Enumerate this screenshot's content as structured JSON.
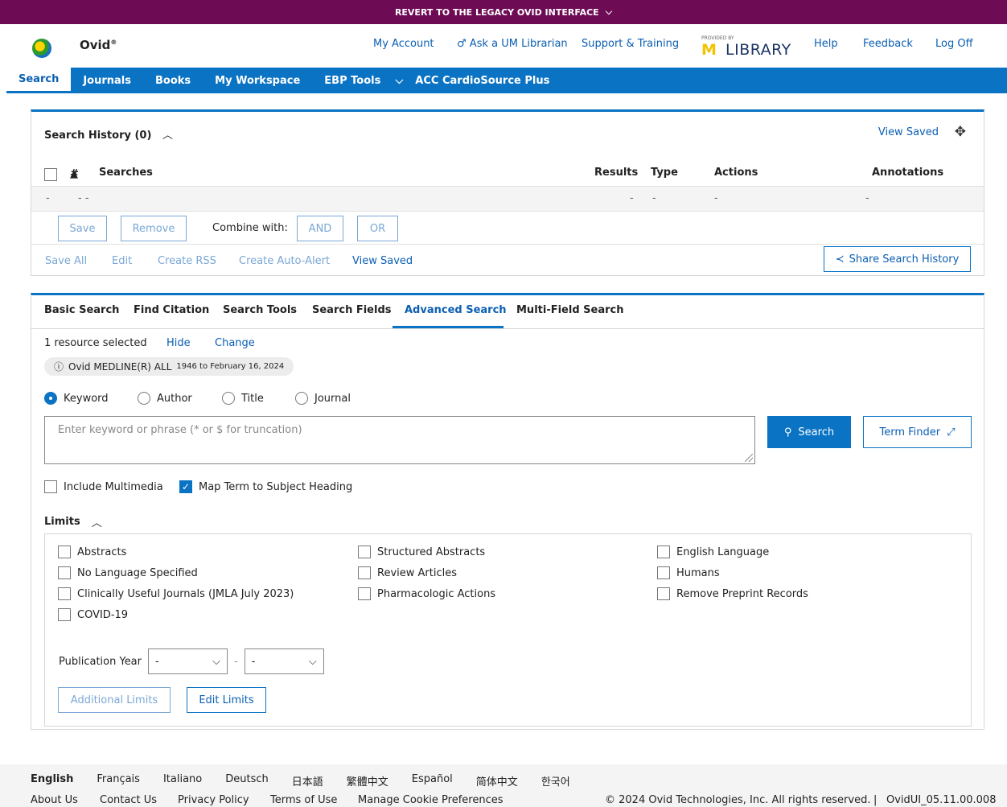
{
  "banner": {
    "text": "REVERT TO THE LEGACY OVID INTERFACE"
  },
  "header": {
    "logo_text": "Ovid",
    "links": {
      "my_account": "My Account",
      "ask_librarian": "Ask a UM Librarian",
      "support": "Support & Training",
      "help": "Help",
      "feedback": "Feedback",
      "logoff": "Log Off"
    },
    "library_logo": {
      "provided_by": "PROVIDED BY",
      "m": "M",
      "library": "LIBRARY"
    }
  },
  "nav": {
    "items": [
      "Search",
      "Journals",
      "Books",
      "My Workspace",
      "EBP Tools",
      "ACC CardioSource Plus"
    ],
    "active": "Search"
  },
  "history": {
    "title": "Search History (0)",
    "view_saved": "View Saved",
    "columns": {
      "num": "#",
      "searches": "Searches",
      "results": "Results",
      "type": "Type",
      "actions": "Actions",
      "annotations": "Annotations"
    },
    "empty_row": {
      "num": "-",
      "searches": "-  -",
      "results": "-",
      "type": "-",
      "actions": "-",
      "annotations": "-"
    },
    "buttons": {
      "save": "Save",
      "remove": "Remove",
      "combine_with": "Combine with:",
      "and": "AND",
      "or": "OR"
    },
    "links": {
      "save_all": "Save All",
      "edit": "Edit",
      "create_rss": "Create RSS",
      "create_auto_alert": "Create Auto-Alert",
      "view_saved": "View Saved"
    },
    "share": "Share Search History"
  },
  "search": {
    "tabs": [
      "Basic Search",
      "Find Citation",
      "Search Tools",
      "Search Fields",
      "Advanced Search",
      "Multi-Field Search"
    ],
    "active_tab": "Advanced Search",
    "resource_selected": "1 resource selected",
    "hide": "Hide",
    "change": "Change",
    "database": {
      "name": "Ovid MEDLINE(R) ALL",
      "range": "1946 to February 16, 2024"
    },
    "radios": [
      {
        "label": "Keyword",
        "selected": true
      },
      {
        "label": "Author",
        "selected": false
      },
      {
        "label": "Title",
        "selected": false
      },
      {
        "label": "Journal",
        "selected": false
      }
    ],
    "input": {
      "placeholder": "Enter keyword or phrase (* or $ for truncation)",
      "value": ""
    },
    "search_button": "Search",
    "term_finder_button": "Term Finder",
    "options": [
      {
        "label": "Include Multimedia",
        "checked": false
      },
      {
        "label": "Map Term to Subject Heading",
        "checked": true
      }
    ],
    "limits": {
      "title": "Limits",
      "col1": [
        "Abstracts",
        "No Language Specified",
        "Clinically Useful Journals (JMLA July 2023)",
        "COVID-19"
      ],
      "col2": [
        "Structured Abstracts",
        "Review Articles",
        "Pharmacologic Actions"
      ],
      "col3": [
        "English Language",
        "Humans",
        "Remove Preprint Records"
      ],
      "publication_year": {
        "label": "Publication Year",
        "from": "-",
        "to": "-",
        "separator": "-"
      },
      "additional_limits": "Additional Limits",
      "edit_limits": "Edit Limits"
    }
  },
  "footer": {
    "languages": [
      "English",
      "Français",
      "Italiano",
      "Deutsch",
      "日本語",
      "繁體中文",
      "Español",
      "简体中文",
      "한국어"
    ],
    "current_language": "English",
    "links": {
      "about": "About Us",
      "contact": "Contact Us",
      "privacy": "Privacy Policy",
      "terms": "Terms of Use",
      "cookies": "Manage Cookie Preferences"
    },
    "copyright": "© 2024 Ovid Technologies, Inc. All rights reserved.",
    "separator": "|",
    "version": "OvidUI_05.11.00.008"
  },
  "colors": {
    "banner": "#6e0b55",
    "nav": "#0b73c4",
    "link": "#0b5fb3"
  }
}
